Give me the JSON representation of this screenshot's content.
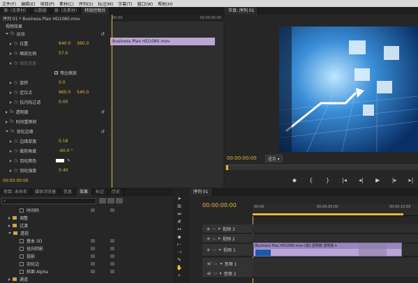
{
  "menu": [
    "文件(F)",
    "编辑(E)",
    "项目(P)",
    "素材(C)",
    "序列(S)",
    "标记(M)",
    "字幕(T)",
    "窗口(W)",
    "帮助(H)"
  ],
  "top_tabs": [
    "源: (无素材)",
    "元数据",
    "源: (无素材)",
    "特效控制台"
  ],
  "fx_panel": {
    "header": "序列 01 * Business Plan HD1080.mov",
    "section": "视频效果",
    "clip_name": "Business Plan HD1080.mov",
    "timecode_start": "00:00",
    "timecode_end": "00:00:05:00",
    "rows": [
      {
        "label": "运动",
        "level": 0,
        "expanded": true,
        "reset": true
      },
      {
        "label": "位置",
        "level": 1,
        "v1": "640.0",
        "v2": "360.0"
      },
      {
        "label": "缩放比例",
        "level": 1,
        "v1": "57.0"
      },
      {
        "label": "缩放宽度",
        "level": 1,
        "disabled": true
      },
      {
        "label": "等比缩放",
        "level": 2,
        "checkbox": true
      },
      {
        "label": "旋转",
        "level": 1,
        "v1": "0.0"
      },
      {
        "label": "定位点",
        "level": 1,
        "v1": "960.0",
        "v2": "540.0"
      },
      {
        "label": "抗闪烁过滤",
        "level": 1,
        "v1": "0.00"
      },
      {
        "label": "透明度",
        "level": 0,
        "expanded": false,
        "reset": true
      },
      {
        "label": "时间重映射",
        "level": 0,
        "expanded": false
      },
      {
        "label": "羽化边缘",
        "level": 0,
        "expanded": true,
        "reset": true
      },
      {
        "label": "边缘厚度",
        "level": 1,
        "v1": "0.18"
      },
      {
        "label": "裁剪角度",
        "level": 1,
        "v1": "-60.0 °"
      },
      {
        "label": "羽化颜色",
        "level": 1,
        "swatch": true
      },
      {
        "label": "羽化强度",
        "level": 1,
        "v1": "0.40"
      }
    ],
    "footer_time": "00:00:00:00"
  },
  "program": {
    "tab": "节目: 序列 01",
    "timecode": "00:00:00:00",
    "fit": "适合"
  },
  "bottom_tabs": [
    "项目: 未命名",
    "媒体浏览器",
    "信息",
    "效果",
    "标记",
    "历史"
  ],
  "effects_list": [
    {
      "label": "时间码",
      "level": 1,
      "type": "item"
    },
    {
      "label": "调整",
      "level": 0,
      "type": "folder"
    },
    {
      "label": "过渡",
      "level": 0,
      "type": "folder"
    },
    {
      "label": "透视",
      "level": 0,
      "type": "folder",
      "expanded": true
    },
    {
      "label": "基本 3D",
      "level": 1,
      "type": "item"
    },
    {
      "label": "径向阴影",
      "level": 1,
      "type": "item"
    },
    {
      "label": "投影",
      "level": 1,
      "type": "item"
    },
    {
      "label": "羽化边",
      "level": 1,
      "type": "item"
    },
    {
      "label": "斜面 Alpha",
      "level": 1,
      "type": "item"
    },
    {
      "label": "通道",
      "level": 0,
      "type": "folder"
    }
  ],
  "timeline": {
    "tab": "序列 01",
    "timecode": "00:00:00:00",
    "ruler": [
      "00:00",
      "00:00:05:00",
      "00:00:10:00"
    ],
    "tracks": [
      "视频 3",
      "视频 2",
      "视频 1",
      "音频 1",
      "音频 2"
    ],
    "clip_label": "Business Plan HD1080.mov [视] 透明度:透明度 ▾"
  },
  "colors": {
    "accent": "#e6b83a",
    "clip": "#b9a6d6",
    "timecode": "#e6b83a"
  }
}
